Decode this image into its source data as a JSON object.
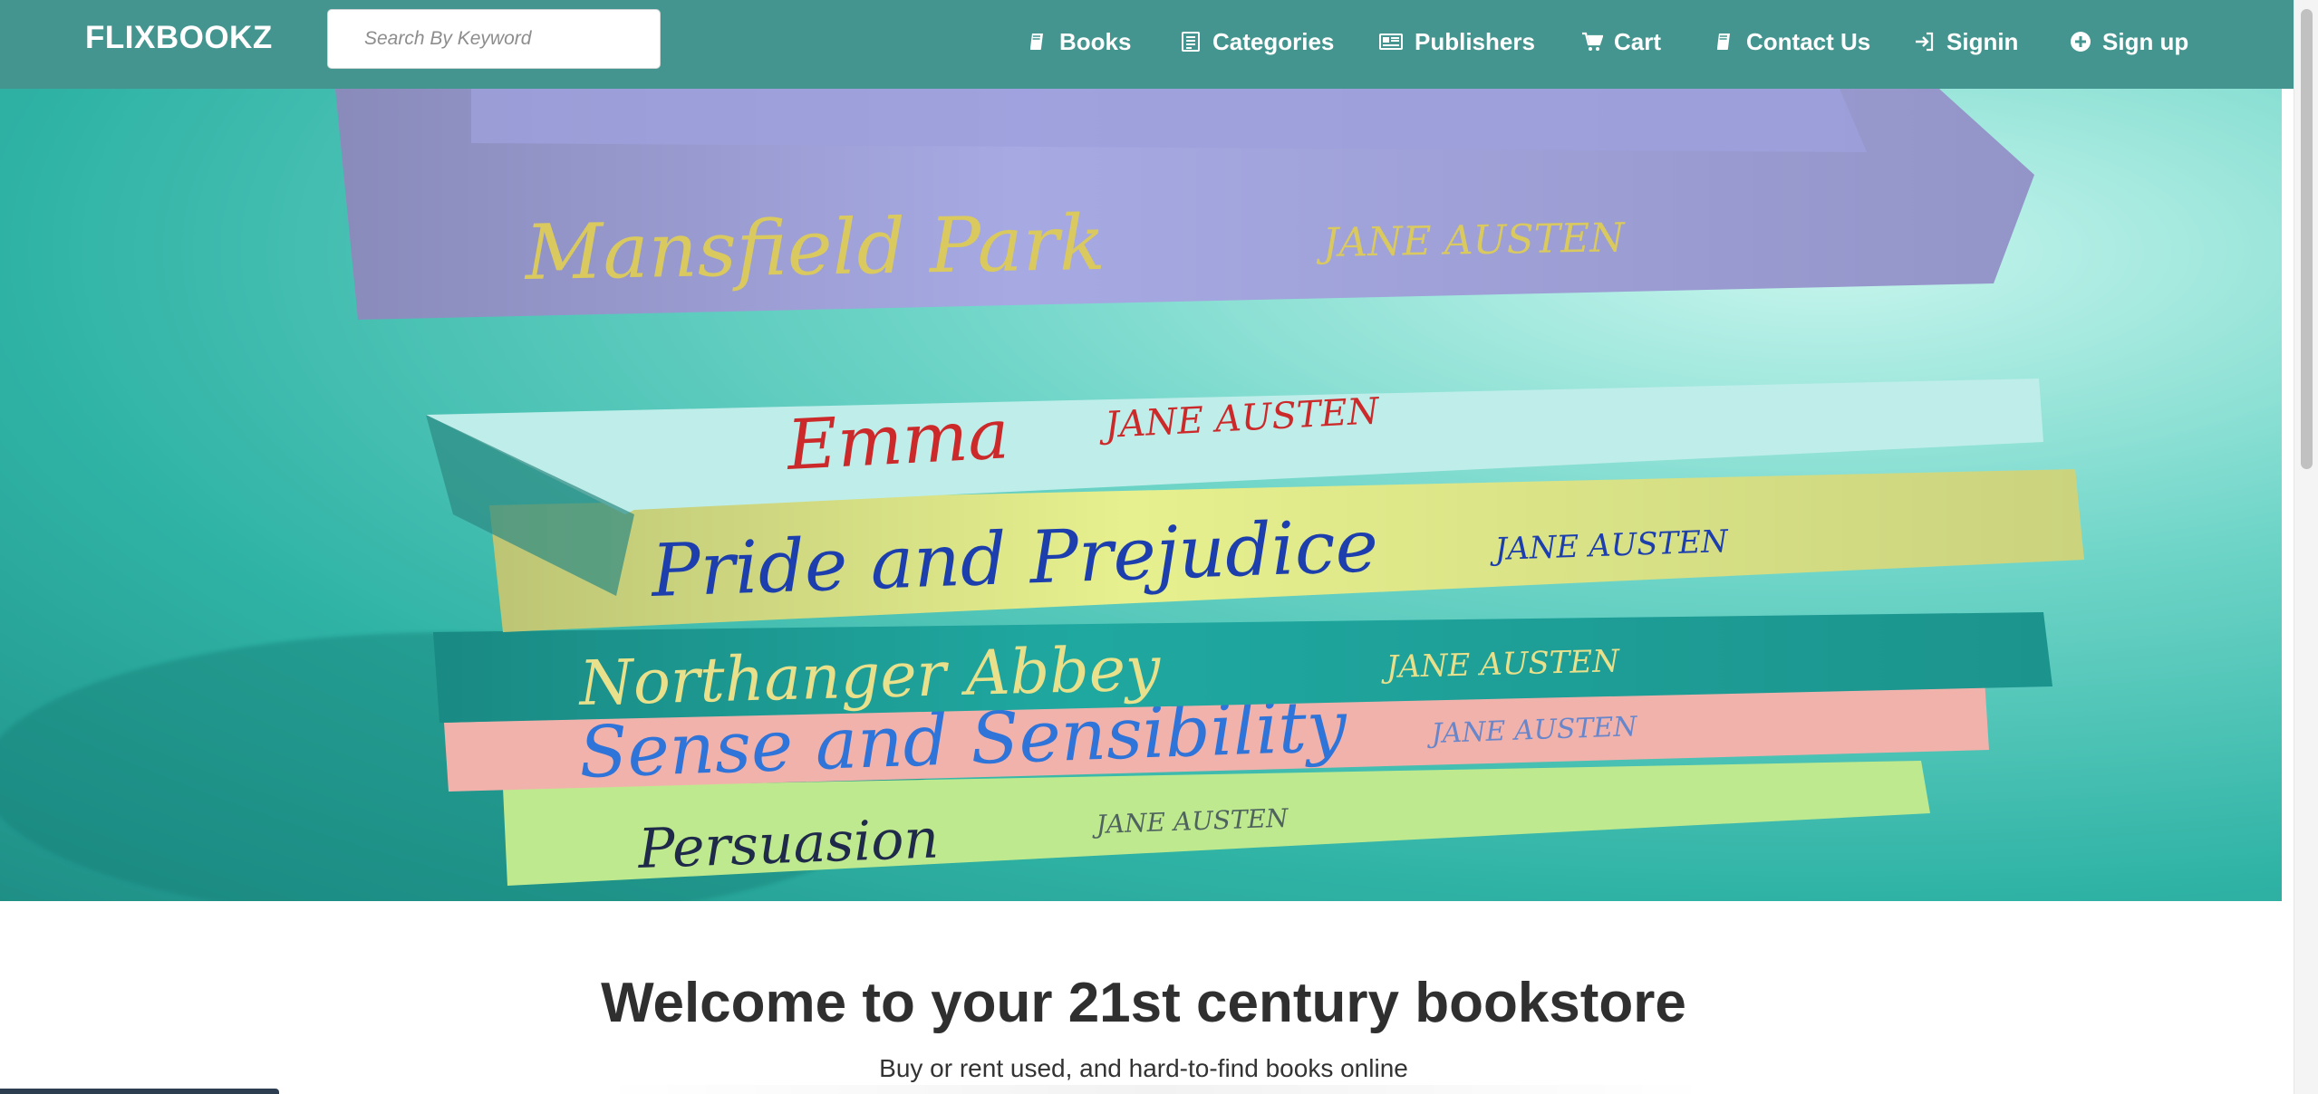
{
  "brand": {
    "name": "FLIXBOOKZ"
  },
  "search": {
    "placeholder": "Search By Keyword",
    "value": ""
  },
  "nav": {
    "items": [
      {
        "label": "Books",
        "icon": "book-icon"
      },
      {
        "label": "Categories",
        "icon": "list-icon"
      },
      {
        "label": "Publishers",
        "icon": "newspaper-icon"
      },
      {
        "label": "Cart",
        "icon": "cart-icon"
      },
      {
        "label": "Contact Us",
        "icon": "book-icon"
      },
      {
        "label": "Signin",
        "icon": "sign-in-icon"
      },
      {
        "label": "Sign up",
        "icon": "plus-circle-icon"
      }
    ]
  },
  "hero": {
    "image": "hero-books-image",
    "spines": [
      {
        "title": "Mansfield Park",
        "author": "JANE AUSTEN",
        "color": "#a7a9e3",
        "text_color": "#d9c95f"
      },
      {
        "title": "Emma",
        "author": "JANE AUSTEN",
        "color": "#bfeeea",
        "text_color": "#cc2a2a"
      },
      {
        "title": "Pride and Prejudice",
        "author": "JANE AUSTEN",
        "color": "#e6f08e",
        "text_color": "#1d3fae"
      },
      {
        "title": "Northanger Abbey",
        "author": "JANE AUSTEN",
        "color": "#1fa8a0",
        "text_color": "#e8e08a"
      },
      {
        "title": "Sense and Sensibility",
        "author": "JANE AUSTEN",
        "color": "#f2b2ac",
        "text_color": "#2f74d8"
      },
      {
        "title": "Persuasion",
        "author": "JANE AUSTEN",
        "color": "#bfe98f",
        "text_color": "#1f2a4a"
      }
    ]
  },
  "welcome": {
    "title": "Welcome to your 21st century bookstore",
    "subtitle": "Buy or rent used, and hard-to-find books online"
  },
  "colors": {
    "navbar": "#44958f",
    "text_dark": "#2f2f2f"
  }
}
